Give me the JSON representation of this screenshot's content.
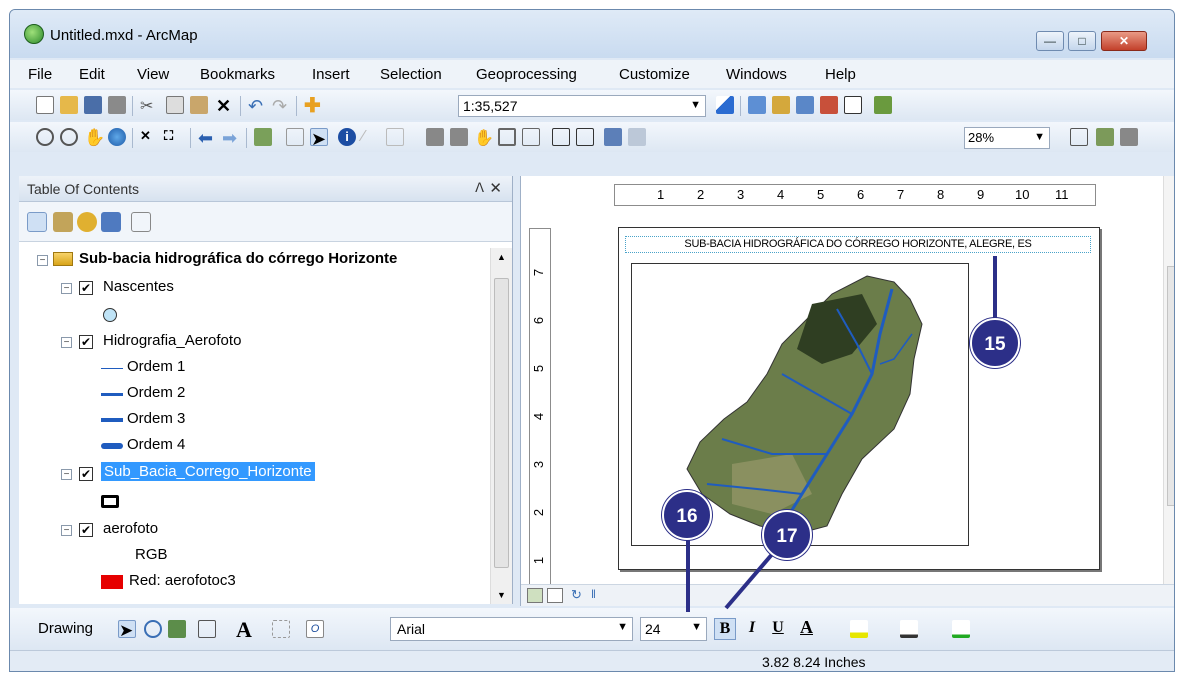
{
  "window": {
    "title": "Untitled.mxd - ArcMap",
    "min": "—",
    "max": "□",
    "close": "✕"
  },
  "menu": [
    "File",
    "Edit",
    "View",
    "Bookmarks",
    "Insert",
    "Selection",
    "Geoprocessing",
    "Customize",
    "Windows",
    "Help"
  ],
  "toolbar": {
    "scale": "1:35,527",
    "zoom": "28%"
  },
  "toc": {
    "title": "Table Of Contents",
    "pin": "ᐱ",
    "close": "✕",
    "group": "Sub-bacia hidrográfica do córrego Horizonte",
    "layers": {
      "nascentes": "Nascentes",
      "hidrografia": "Hidrografia_Aerofoto",
      "ordem": [
        "Ordem 1",
        "Ordem 2",
        "Ordem 3",
        "Ordem 4"
      ],
      "subbacia": "Sub_Bacia_Corrego_Horizonte",
      "aerofoto": "aerofoto",
      "rgb": "RGB",
      "red": "Red:   aerofotoc3"
    }
  },
  "layout": {
    "map_title": "SUB-BACIA HIDROGRÁFICA DO CÓRREGO HORIZONTE, ALEGRE, ES",
    "ruler_h": [
      "1",
      "2",
      "3",
      "4",
      "5",
      "6",
      "7",
      "8",
      "9",
      "10",
      "11"
    ],
    "ruler_v": [
      "7",
      "6",
      "5",
      "4",
      "3",
      "2",
      "1"
    ]
  },
  "drawing": {
    "label": "Drawing",
    "font": "Arial",
    "size": "24",
    "bold": "B",
    "italic": "I",
    "underline": "U"
  },
  "status": {
    "coords": "3.82  8.24 Inches"
  },
  "callouts": {
    "c15": "15",
    "c16": "16",
    "c17": "17"
  },
  "colors": {
    "selection": "#3399ff",
    "callout": "#2c2f88",
    "stream": "#1f5cbf"
  }
}
